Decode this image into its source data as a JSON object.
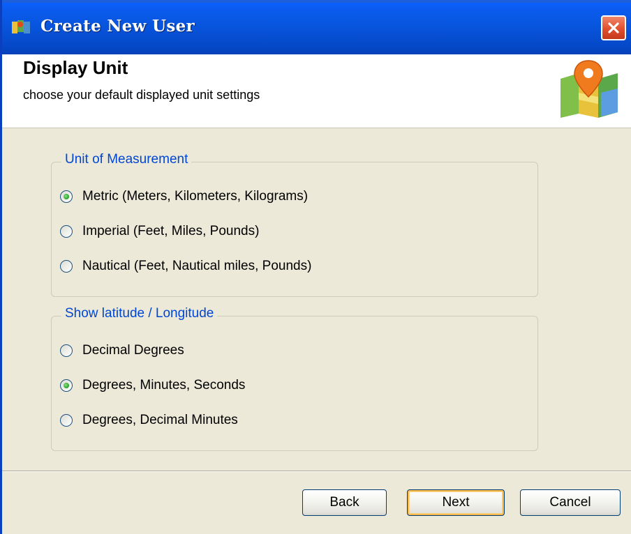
{
  "window": {
    "title": "Create New User",
    "icons": {
      "app": "map-app-icon",
      "close": "close-icon"
    }
  },
  "header": {
    "heading": "Display Unit",
    "subheading": "choose your default displayed unit settings",
    "icon": "map-pin-icon"
  },
  "groups": {
    "units": {
      "legend": "Unit of Measurement",
      "options": [
        {
          "label": "Metric (Meters, Kilometers, Kilograms)",
          "checked": true
        },
        {
          "label": "Imperial (Feet, Miles, Pounds)",
          "checked": false
        },
        {
          "label": "Nautical (Feet, Nautical miles, Pounds)",
          "checked": false
        }
      ]
    },
    "latlon": {
      "legend": "Show latitude / Longitude",
      "options": [
        {
          "label": "Decimal Degrees",
          "checked": false
        },
        {
          "label": "Degrees, Minutes, Seconds",
          "checked": true
        },
        {
          "label": "Degrees, Decimal Minutes",
          "checked": false
        }
      ]
    }
  },
  "buttons": {
    "back": "Back",
    "next": "Next",
    "cancel": "Cancel"
  },
  "colors": {
    "titlebar": "#0855dd",
    "legend_text": "#0046d5",
    "dialog_bg": "#ece9d8",
    "close_button": "#e0502f"
  }
}
